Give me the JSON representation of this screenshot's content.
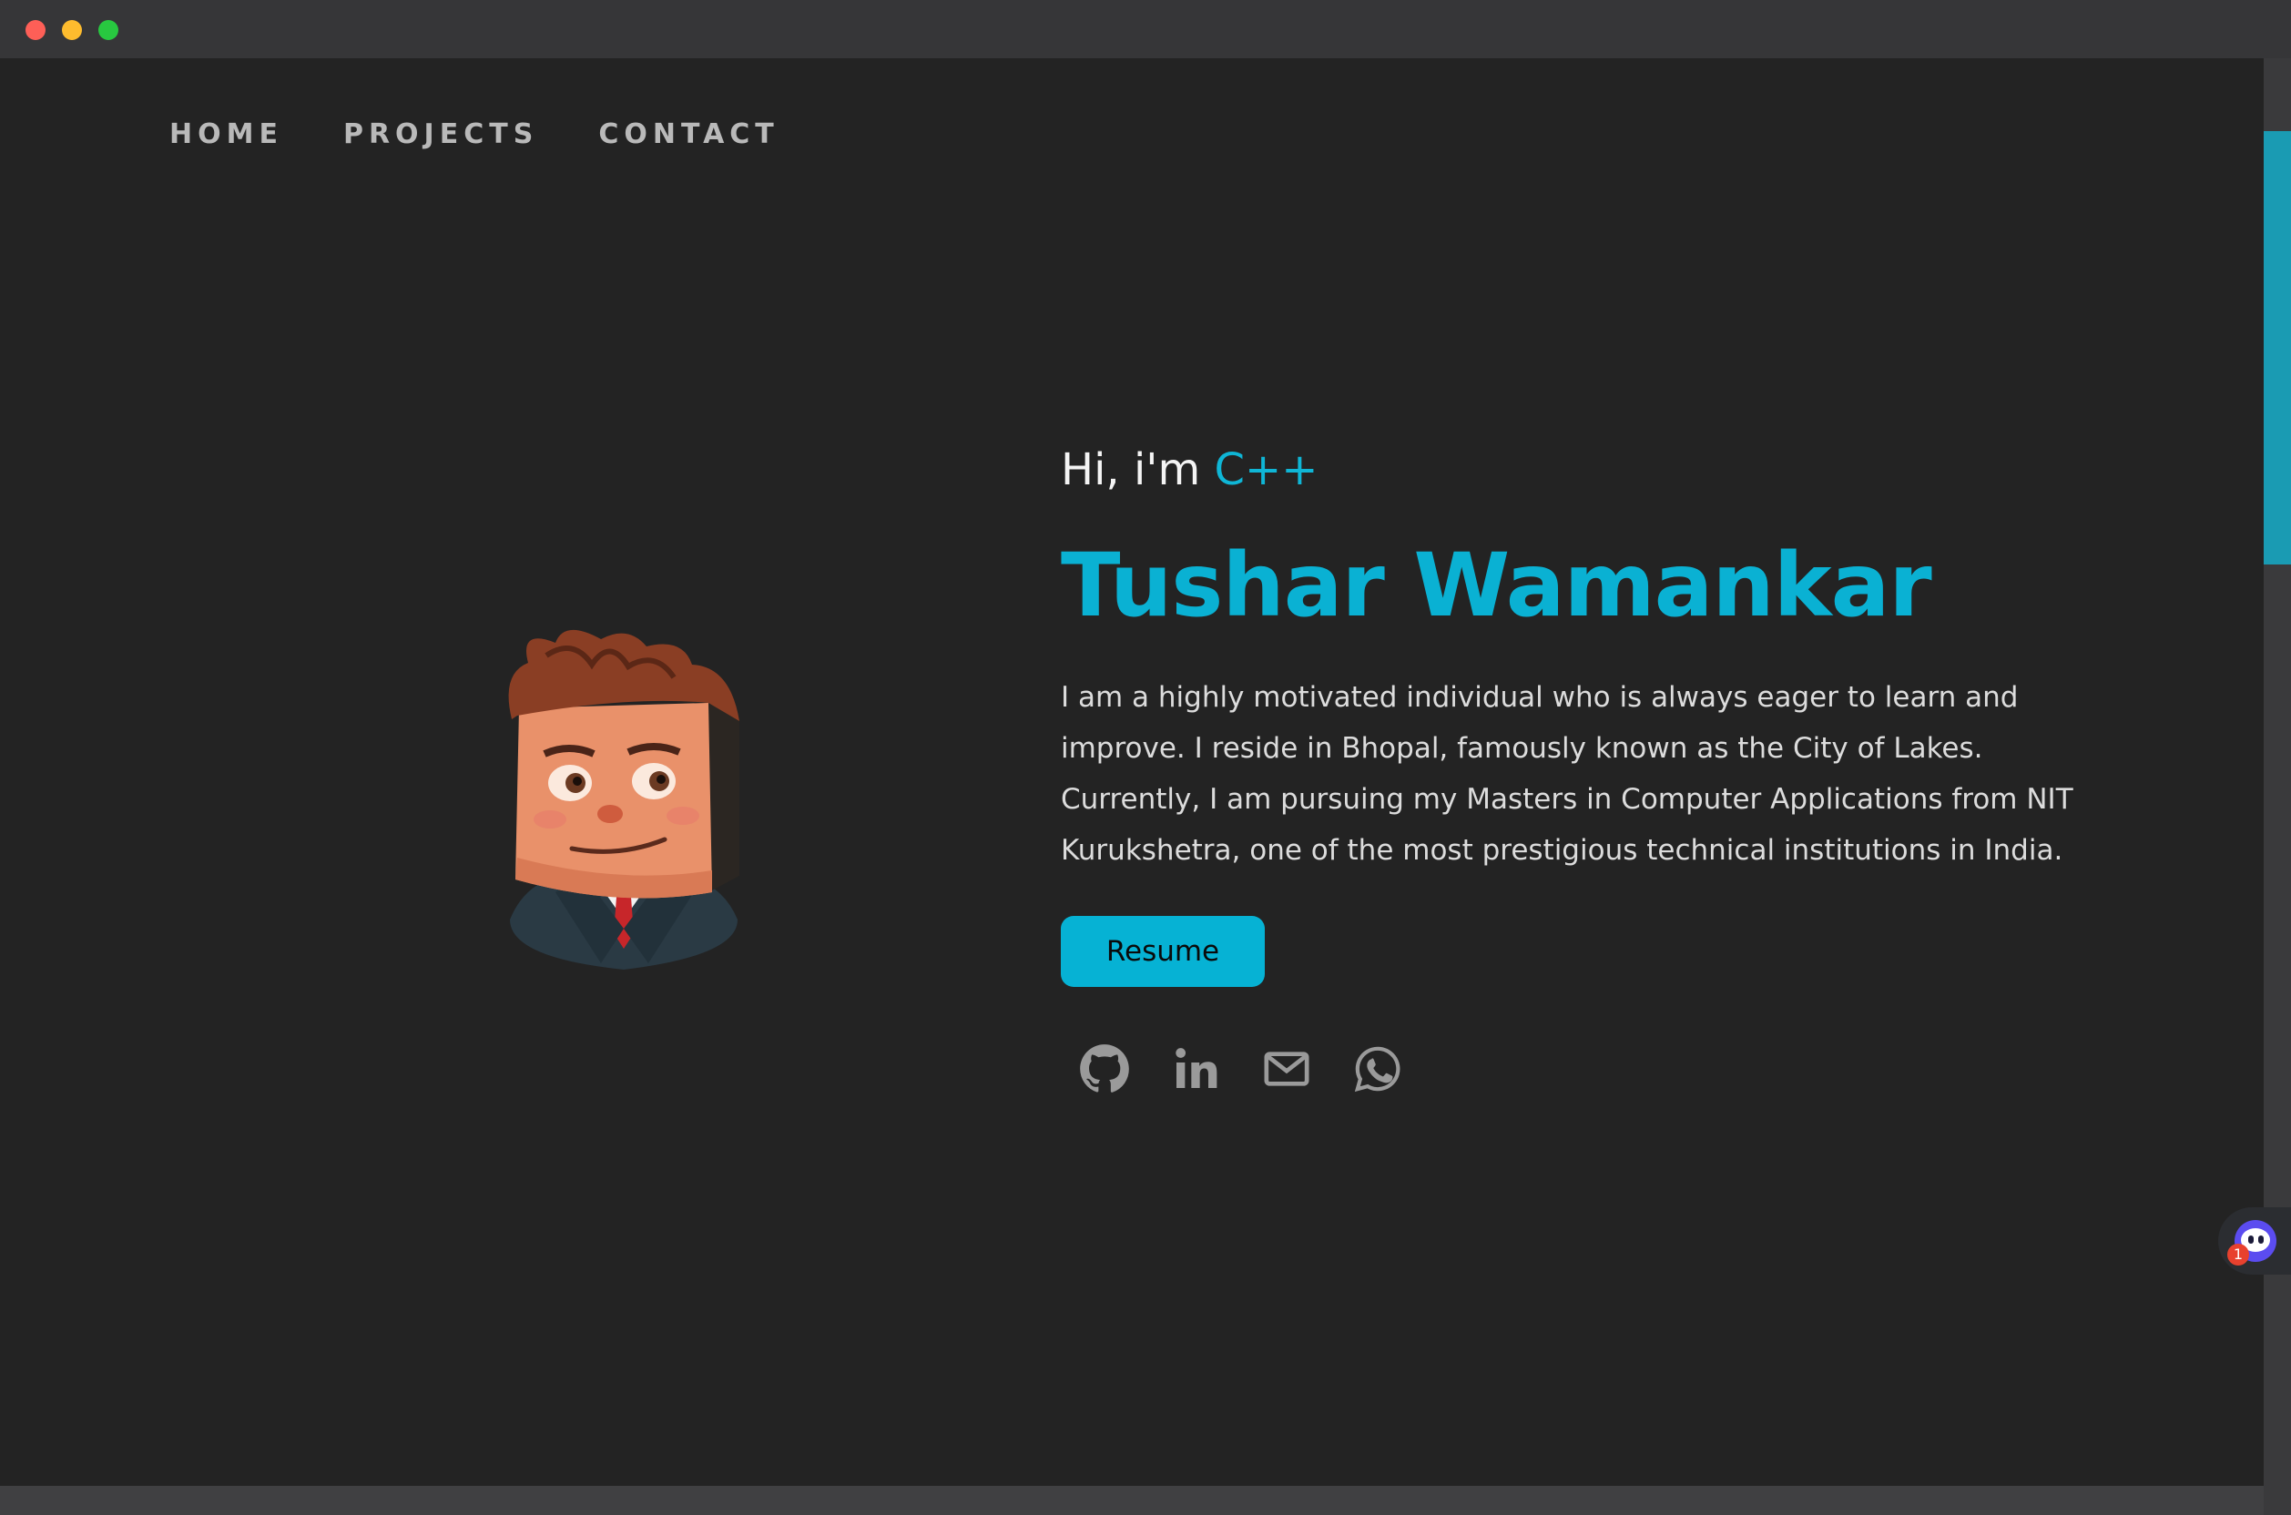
{
  "nav": {
    "items": [
      {
        "label": "HOME"
      },
      {
        "label": "PROJECTS"
      },
      {
        "label": "CONTACT"
      }
    ]
  },
  "hero": {
    "greeting_prefix": "Hi, i'm ",
    "greeting_highlight": "C++",
    "name": "Tushar Wamankar",
    "bio": "I am a highly motivated individual who is always eager to learn and improve. I reside in Bhopal, famously known as the City of Lakes. Currently, I am pursuing my Masters in Computer Applications from NIT Kurukshetra, one of the most prestigious technical institutions in India.",
    "resume_label": "Resume"
  },
  "socials": [
    {
      "icon": "github-icon"
    },
    {
      "icon": "linkedin-icon"
    },
    {
      "icon": "mail-icon"
    },
    {
      "icon": "whatsapp-icon"
    }
  ],
  "widget": {
    "badge_count": "1"
  },
  "colors": {
    "accent": "#0ab1d3",
    "background": "#232323",
    "nav_text": "#b9b9b9",
    "body_text": "#dcdcdc",
    "icon": "#9a9a9a"
  }
}
